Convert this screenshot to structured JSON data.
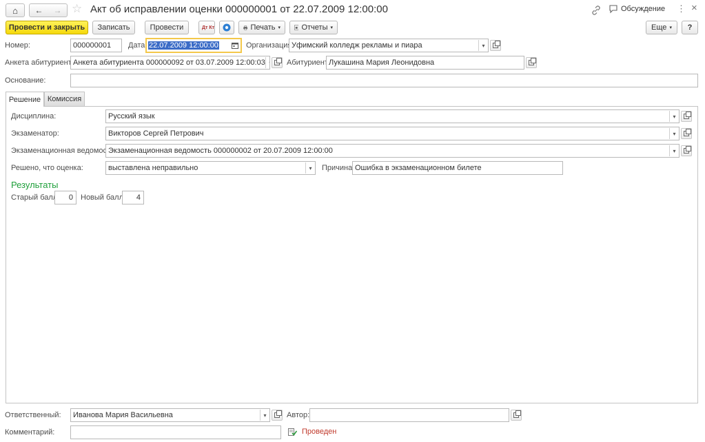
{
  "header": {
    "title": "Акт об исправлении оценки 000000001 от 22.07.2009 12:00:00",
    "discussion_label": "Обсуждение",
    "more_glyph": "⋮",
    "close_glyph": "×",
    "home_glyph": "⌂",
    "back_glyph": "←",
    "forward_glyph": "→",
    "star_glyph": "☆"
  },
  "toolbar": {
    "post_and_close": "Провести и закрыть",
    "save": "Записать",
    "post": "Провести",
    "dtkt_label": "Дт Кт",
    "print": "Печать",
    "reports": "Отчеты",
    "more": "Еще",
    "help": "?"
  },
  "fields": {
    "number_label": "Номер:",
    "number_value": "000000001",
    "date_label": "Дата:",
    "date_value": "22.07.2009 12:00:00",
    "org_label": "Организация:",
    "org_value": "Уфимский колледж рекламы и пиара",
    "app_form_label": "Анкета абитуриента:",
    "app_form_value": "Анкета абитуриента 000000092 от 03.07.2009 12:00:03",
    "applicant_label": "Абитуриент:",
    "applicant_value": "Лукашина Мария Леонидовна",
    "basis_label": "Основание:",
    "basis_value": ""
  },
  "tabs": [
    {
      "label": "Решение"
    },
    {
      "label": "Комиссия"
    }
  ],
  "decision": {
    "discipline_label": "Дисциплина:",
    "discipline_value": "Русский язык",
    "examiner_label": "Экзаменатор:",
    "examiner_value": "Викторов Сергей Петрович",
    "sheet_label": "Экзаменационная ведомость:",
    "sheet_value": "Экзаменационная ведомость 000000002 от 20.07.2009 12:00:00",
    "decided_label": "Решено, что оценка:",
    "decided_value": "выставлена неправильно",
    "reason_label": "Причина:",
    "reason_value": "Ошибка в экзаменационном билете",
    "results_heading": "Результаты",
    "old_score_label": "Старый балл:",
    "old_score_value": "0",
    "new_score_label": "Новый балл:",
    "new_score_value": "4"
  },
  "footer": {
    "responsible_label": "Ответственный:",
    "responsible_value": "Иванова Мария Васильевна",
    "author_label": "Автор:",
    "author_value": "",
    "comment_label": "Комментарий:",
    "comment_value": "",
    "status_text": "Проведен"
  },
  "colors": {
    "accent_yellow": "#f5d90b",
    "results_green": "#1e9f3a",
    "status_red": "#c0392b",
    "focus_border": "#f4c84a"
  }
}
